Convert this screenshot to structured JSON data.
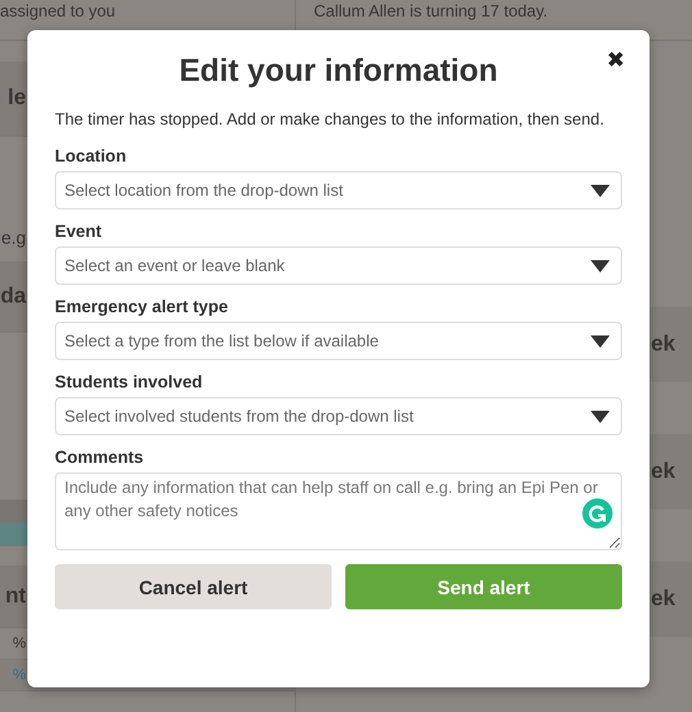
{
  "background": {
    "notices": [
      "assigned to you",
      "Callum Allen is turning 17 today."
    ],
    "left_fragments": [
      {
        "kind": "heading",
        "text": "le"
      },
      {
        "kind": "text",
        "text": "e.g"
      },
      {
        "kind": "heading",
        "text": "da"
      },
      {
        "kind": "teal"
      },
      {
        "kind": "heading",
        "text": "nt"
      },
      {
        "kind": "small",
        "text": "%"
      },
      {
        "kind": "link",
        "text": "%"
      }
    ],
    "right_fragments": [
      "ek",
      "ek",
      "ek"
    ]
  },
  "dialog": {
    "title": "Edit your information",
    "close": "✖",
    "intro": "The timer has stopped. Add or make changes to the information, then send.",
    "fields": [
      {
        "kind": "select",
        "label": "Location",
        "placeholder": "Select location from the drop-down list"
      },
      {
        "kind": "select",
        "label": "Event",
        "placeholder": "Select an event or leave blank"
      },
      {
        "kind": "select",
        "label": "Emergency alert type",
        "placeholder": "Select a type from the list below if available"
      },
      {
        "kind": "select",
        "label": "Students involved",
        "placeholder": "Select involved students from the drop-down list"
      },
      {
        "kind": "textarea",
        "label": "Comments",
        "placeholder": "Include any information that can help staff on call e.g. bring an Epi Pen or any other safety notices"
      }
    ],
    "buttons": [
      {
        "kind": "secondary",
        "label": "Cancel alert"
      },
      {
        "kind": "primary",
        "label": "Send alert"
      }
    ]
  }
}
